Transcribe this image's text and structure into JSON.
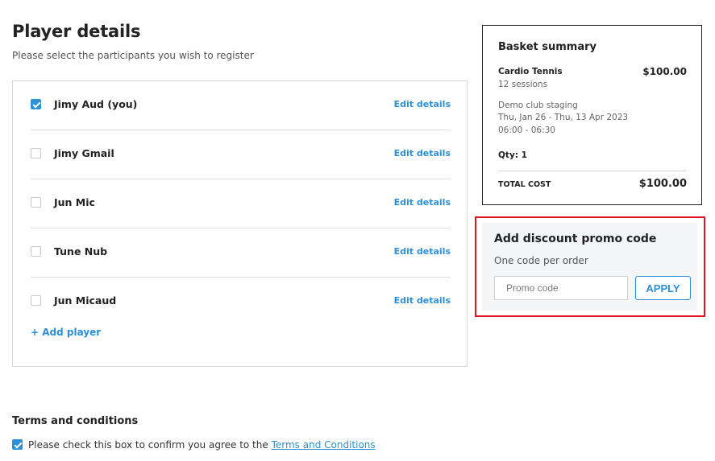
{
  "header": {
    "title": "Player details",
    "subtitle": "Please select the participants you wish to register"
  },
  "players": {
    "items": [
      {
        "name": "Jimy Aud (you)",
        "checked": true,
        "edit_label": "Edit details"
      },
      {
        "name": "Jimy Gmail",
        "checked": false,
        "edit_label": "Edit details"
      },
      {
        "name": "Jun Mic",
        "checked": false,
        "edit_label": "Edit details"
      },
      {
        "name": "Tune Nub",
        "checked": false,
        "edit_label": "Edit details"
      },
      {
        "name": "Jun Micaud",
        "checked": false,
        "edit_label": "Edit details"
      }
    ],
    "add_label": "+ Add player"
  },
  "basket": {
    "title": "Basket summary",
    "course_name": "Cardio Tennis",
    "course_price": "$100.00",
    "sessions": "12 sessions",
    "club": "Demo club staging",
    "dates": "Thu, Jan 26 - Thu, 13 Apr 2023",
    "times": "06:00 - 06:30",
    "qty": "Qty: 1",
    "total_label": "TOTAL COST",
    "total_value": "$100.00"
  },
  "promo": {
    "title": "Add discount promo code",
    "subtitle": "One code per order",
    "placeholder": "Promo code",
    "value": "",
    "apply_label": "APPLY"
  },
  "terms": {
    "title": "Terms and conditions",
    "checked": true,
    "text": "Please check this box to confirm you agree to the ",
    "link": "Terms and Conditions"
  },
  "colors": {
    "accent": "#2d8fd5",
    "highlight": "#e0141e",
    "panel": "#f4f5f7"
  },
  "icons": {
    "checkbox_checked": "checkmark-icon"
  }
}
